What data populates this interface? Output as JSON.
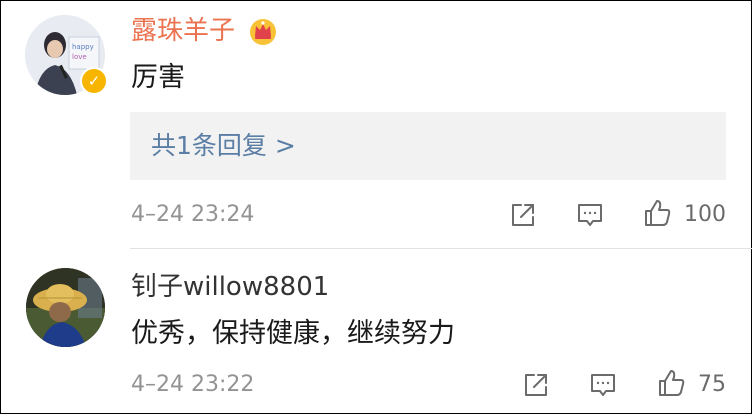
{
  "comments": [
    {
      "user": "露珠羊子",
      "text": "厉害",
      "reply_link": "共1条回复 >",
      "time": "4–24 23:24",
      "likes": "100",
      "verified": true,
      "badge_icon": "crown-icon"
    },
    {
      "user": "钊子willow8801",
      "text": "优秀，保持健康，继续努力",
      "time": "4–24 23:22",
      "likes": "75"
    }
  ],
  "colors": {
    "username_highlight": "#eb7350",
    "username_normal": "#333333",
    "link": "#5b7ea5",
    "meta": "#939393",
    "reply_bg": "#f2f2f2",
    "verified_badge": "#f7b500"
  },
  "icons": [
    "share-icon",
    "comment-icon",
    "like-icon",
    "crown-icon",
    "verified-icon"
  ]
}
